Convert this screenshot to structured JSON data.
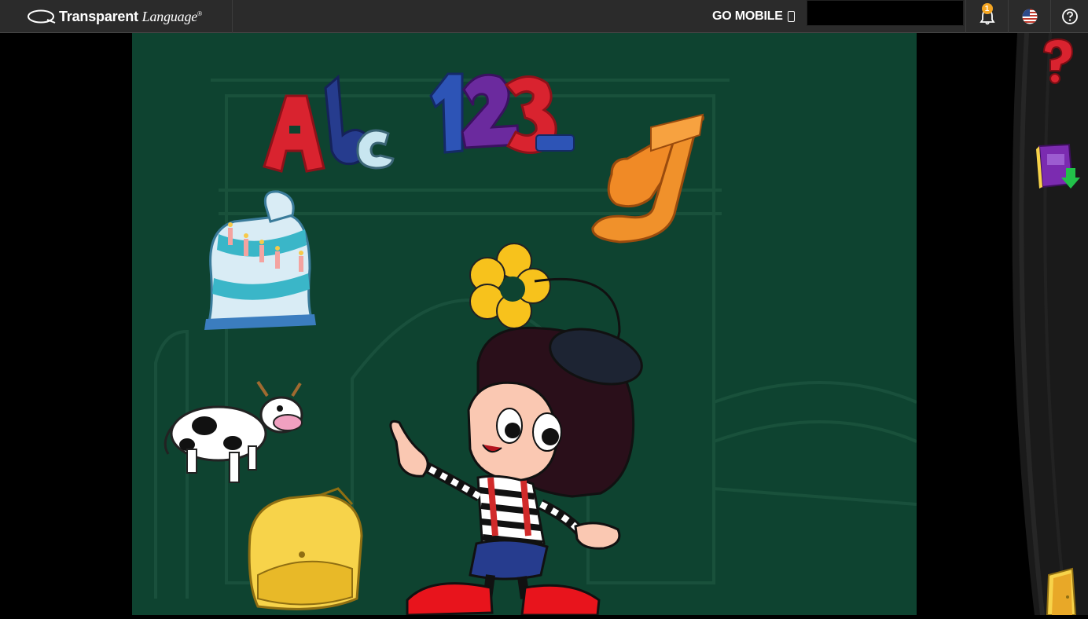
{
  "header": {
    "brand_bold": "Transparent",
    "brand_italic": "Language",
    "brand_reg": "®",
    "go_mobile": "GO MOBILE",
    "notification_count": "1",
    "language_flag": "us-flag-icon",
    "help_icon": "question-icon"
  },
  "colors": {
    "topbar": "#2b2b2b",
    "stage": "#0e4330",
    "badge": "#f5a623"
  },
  "game": {
    "title_icons": [
      "abc-icon",
      "123-icon",
      "music-note-icon"
    ],
    "items": [
      "birthday-cake",
      "cow",
      "backpack",
      "flower"
    ],
    "character": "mime-girl"
  },
  "sidebar": {
    "help": "red-question-icon",
    "download": "download-book-icon",
    "exit": "exit-door-icon"
  }
}
